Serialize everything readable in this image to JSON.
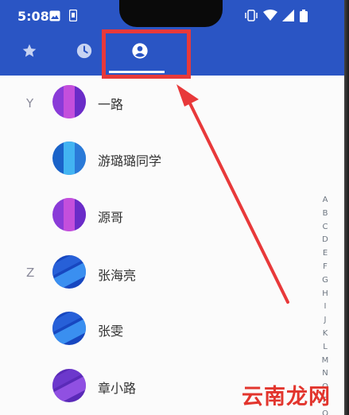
{
  "status": {
    "time": "5:08"
  },
  "tabs": [
    {
      "icon": "star-icon",
      "name": "favorites"
    },
    {
      "icon": "clock-icon",
      "name": "recents"
    },
    {
      "icon": "account-circle-icon",
      "name": "contacts",
      "selected": true
    }
  ],
  "contacts": [
    {
      "letter": "Y",
      "name": "一路",
      "avatar_colors": [
        "#8a3bd8",
        "#c04fd8",
        "#7b2fcf"
      ]
    },
    {
      "letter": "",
      "name": "游璐璐同学",
      "avatar_colors": [
        "#1a63c9",
        "#3fb0f0",
        "#2a7ad8"
      ]
    },
    {
      "letter": "",
      "name": "源哥",
      "avatar_colors": [
        "#8a3bd8",
        "#c04fd8",
        "#7b2fcf"
      ]
    },
    {
      "letter": "Z",
      "name": "张海亮",
      "avatar_colors": [
        "#1747c0",
        "#3a8ff0",
        "#2258d0"
      ]
    },
    {
      "letter": "",
      "name": "张雯",
      "avatar_colors": [
        "#1747c0",
        "#3a8ff0",
        "#2258d0"
      ]
    },
    {
      "letter": "",
      "name": "章小路",
      "avatar_colors": [
        "#5a2ab8",
        "#8e4ee0",
        "#6a35c8"
      ]
    }
  ],
  "index_letters": [
    "A",
    "B",
    "C",
    "D",
    "E",
    "F",
    "G",
    "H",
    "I",
    "J",
    "K",
    "L",
    "M",
    "N",
    "O",
    "P",
    "Q"
  ],
  "watermark": "云南龙网",
  "colors": {
    "appbar": "#2a55c4",
    "highlight": "#e8393a"
  }
}
